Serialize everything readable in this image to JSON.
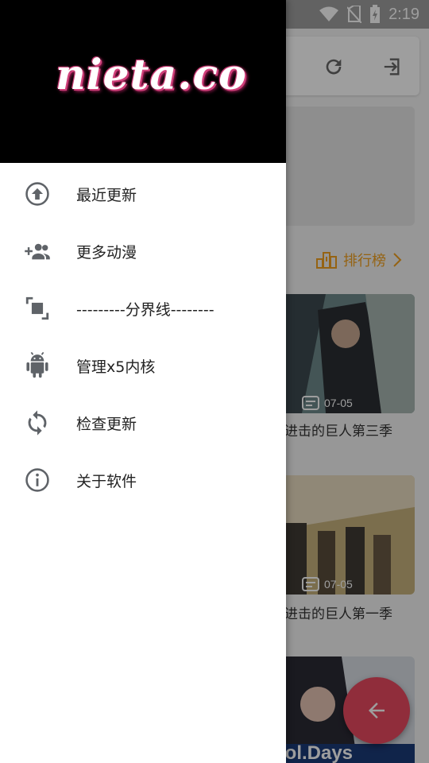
{
  "status_bar": {
    "time": "2:19"
  },
  "background": {
    "ranking_label": "排行榜",
    "cards": [
      {
        "date": "07-05",
        "title": "进击的巨人第三季"
      },
      {
        "date": "07-05",
        "title": "进击的巨人第一季"
      },
      {
        "date": "",
        "title": ""
      }
    ],
    "third_card_caption": "ool.Days"
  },
  "drawer": {
    "logo": "nieta.co",
    "items": [
      {
        "label": "最近更新",
        "icon": "arrow-up-circle-icon"
      },
      {
        "label": "更多动漫",
        "icon": "add-people-icon"
      },
      {
        "label": "---------分界线--------",
        "icon": "selection-frame-icon"
      },
      {
        "label": "管理x5内核",
        "icon": "android-icon"
      },
      {
        "label": "检查更新",
        "icon": "sync-icon"
      },
      {
        "label": "关于软件",
        "icon": "info-icon"
      }
    ]
  },
  "colors": {
    "accent": "#e84a5f",
    "ranking": "#f0a020",
    "icon_gray": "#5f6368"
  }
}
